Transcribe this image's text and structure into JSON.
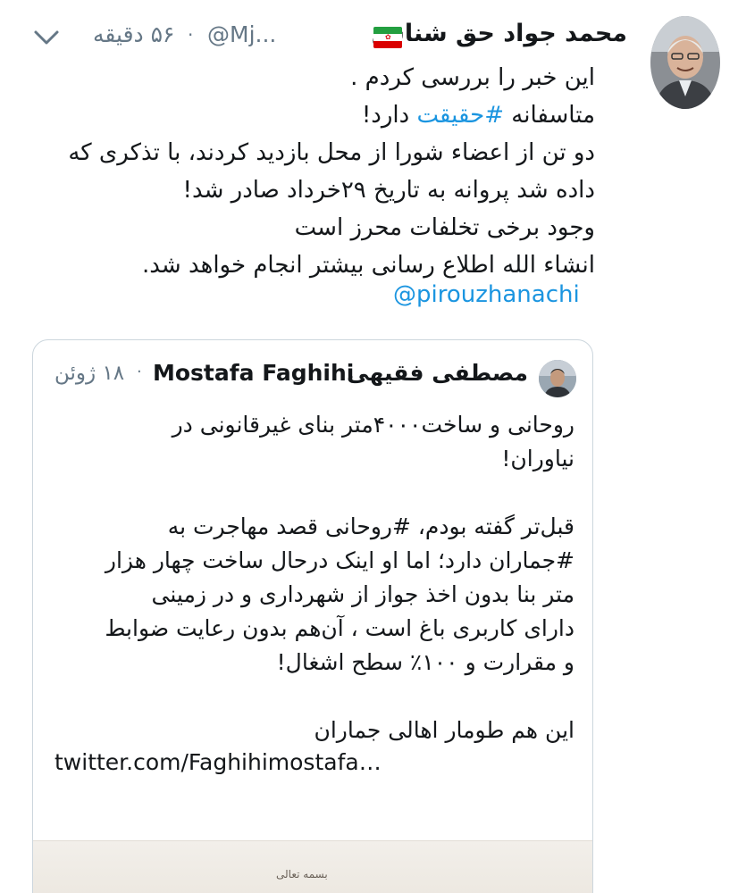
{
  "tweet": {
    "author_name": "محمد جواد حق شناس",
    "handle": "@Mj...",
    "separator": "·",
    "time_ago": "۵۶ دقیقه",
    "text_lines": [
      "این خبر را بررسی کردم .",
      "متاسفانه #حقیقت دارد!",
      "دو تن از اعضاء شورا از محل بازدید کردند، با تذکری که",
      "داده شد پروانه به تاریخ ۲۹خرداد صادر شد!",
      "وجود برخی تخلفات محرز است",
      "انشاء الله اطلاع رسانی بیشتر انجام خواهد شد."
    ],
    "line2_prefix": "متاسفانه ",
    "line2_hashtag": "#حقیقت",
    "line2_suffix": " دارد!",
    "mention": "@pirouzhanachi"
  },
  "quoted_tweet": {
    "name_fa": "مصطفی فقیهی",
    "name_en": "Mostafa Faghihi",
    "separator": "·",
    "date": "۱۸ ژوئن",
    "text_lines": [
      "روحانی و ساخت۴۰۰۰متر بنای غیرقانونی در",
      "نیاوران!",
      "",
      "قبل‌تر گفته بودم، #روحانی قصد مهاجرت به",
      "#جماران دارد؛ اما او اینک درحال ساخت چهار هزار",
      "متر بنا بدون اخذ جواز از شهرداری و در زمینی",
      "دارای کاربری باغ است ، آن‌هم بدون رعایت ضوابط",
      "و مقرارت و ۱۰۰٪ سطح اشغال!",
      "",
      "این هم طومار اهالی جماران"
    ],
    "link": "twitter.com/Faghihimostafa…",
    "image_caption": "بسمه تعالی"
  },
  "colors": {
    "link": "#1b95e0",
    "muted": "#657786",
    "text": "#14171a",
    "border": "#ccd6dd"
  },
  "icons": {
    "menu": "chevron-down-icon",
    "flag": "iran-flag-icon"
  }
}
